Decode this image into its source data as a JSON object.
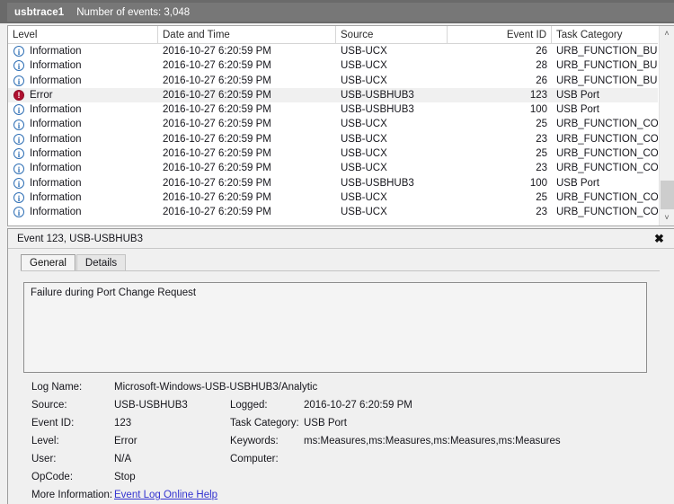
{
  "window": {
    "log_name": "usbtrace1",
    "event_count_label": "Number of events: 3,048"
  },
  "events_list": {
    "columns": [
      {
        "key": "level",
        "label": "Level",
        "align": "left"
      },
      {
        "key": "datetime",
        "label": "Date and Time",
        "align": "left"
      },
      {
        "key": "source",
        "label": "Source",
        "align": "left"
      },
      {
        "key": "event_id",
        "label": "Event ID",
        "align": "right"
      },
      {
        "key": "category",
        "label": "Task Category",
        "align": "left"
      }
    ],
    "rows": [
      {
        "icon": "information-icon",
        "level": "Information",
        "datetime": "2016-10-27 6:20:59 PM",
        "source": "USB-UCX",
        "event_id": "26",
        "category": "URB_FUNCTION_BULK...",
        "selected": false
      },
      {
        "icon": "information-icon",
        "level": "Information",
        "datetime": "2016-10-27 6:20:59 PM",
        "source": "USB-UCX",
        "event_id": "28",
        "category": "URB_FUNCTION_BULK...",
        "selected": false
      },
      {
        "icon": "information-icon",
        "level": "Information",
        "datetime": "2016-10-27 6:20:59 PM",
        "source": "USB-UCX",
        "event_id": "26",
        "category": "URB_FUNCTION_BULK...",
        "selected": false
      },
      {
        "icon": "error-icon",
        "level": "Error",
        "datetime": "2016-10-27 6:20:59 PM",
        "source": "USB-USBHUB3",
        "event_id": "123",
        "category": "USB Port",
        "selected": true
      },
      {
        "icon": "information-icon",
        "level": "Information",
        "datetime": "2016-10-27 6:20:59 PM",
        "source": "USB-USBHUB3",
        "event_id": "100",
        "category": "USB Port",
        "selected": false
      },
      {
        "icon": "information-icon",
        "level": "Information",
        "datetime": "2016-10-27 6:20:59 PM",
        "source": "USB-UCX",
        "event_id": "25",
        "category": "URB_FUNCTION_CON...",
        "selected": false
      },
      {
        "icon": "information-icon",
        "level": "Information",
        "datetime": "2016-10-27 6:20:59 PM",
        "source": "USB-UCX",
        "event_id": "23",
        "category": "URB_FUNCTION_CON...",
        "selected": false
      },
      {
        "icon": "information-icon",
        "level": "Information",
        "datetime": "2016-10-27 6:20:59 PM",
        "source": "USB-UCX",
        "event_id": "25",
        "category": "URB_FUNCTION_CON...",
        "selected": false
      },
      {
        "icon": "information-icon",
        "level": "Information",
        "datetime": "2016-10-27 6:20:59 PM",
        "source": "USB-UCX",
        "event_id": "23",
        "category": "URB_FUNCTION_CON...",
        "selected": false
      },
      {
        "icon": "information-icon",
        "level": "Information",
        "datetime": "2016-10-27 6:20:59 PM",
        "source": "USB-USBHUB3",
        "event_id": "100",
        "category": "USB Port",
        "selected": false
      },
      {
        "icon": "information-icon",
        "level": "Information",
        "datetime": "2016-10-27 6:20:59 PM",
        "source": "USB-UCX",
        "event_id": "25",
        "category": "URB_FUNCTION_CON...",
        "selected": false
      },
      {
        "icon": "information-icon",
        "level": "Information",
        "datetime": "2016-10-27 6:20:59 PM",
        "source": "USB-UCX",
        "event_id": "23",
        "category": "URB_FUNCTION_CON...",
        "selected": false
      }
    ],
    "scrollbar": {
      "up_arrow": "˄",
      "down_arrow": "˅"
    }
  },
  "detail_pane": {
    "title": "Event 123, USB-USBHUB3",
    "close_label": "✖",
    "tabs": [
      {
        "label": "General",
        "active": true
      },
      {
        "label": "Details",
        "active": false
      }
    ],
    "message": "Failure during Port Change Request",
    "fields": {
      "log_name_label": "Log Name:",
      "log_name_value": "Microsoft-Windows-USB-USBHUB3/Analytic",
      "source_label": "Source:",
      "source_value": "USB-USBHUB3",
      "logged_label": "Logged:",
      "logged_value": "2016-10-27 6:20:59 PM",
      "event_id_label": "Event ID:",
      "event_id_value": "123",
      "task_category_label": "Task Category:",
      "task_category_value": "USB Port",
      "level_label": "Level:",
      "level_value": "Error",
      "keywords_label": "Keywords:",
      "keywords_value": "ms:Measures,ms:Measures,ms:Measures,ms:Measures",
      "user_label": "User:",
      "user_value": "N/A",
      "computer_label": "Computer:",
      "computer_value": "",
      "opcode_label": "OpCode:",
      "opcode_value": "Stop",
      "more_info_label": "More Information:",
      "more_info_link": "Event Log Online Help"
    }
  },
  "colors": {
    "title_bar": "#777777",
    "selected_row": "#f0f0f0",
    "error_icon": "#b01030",
    "info_icon": "#2f6fb5",
    "link": "#3434d0"
  }
}
